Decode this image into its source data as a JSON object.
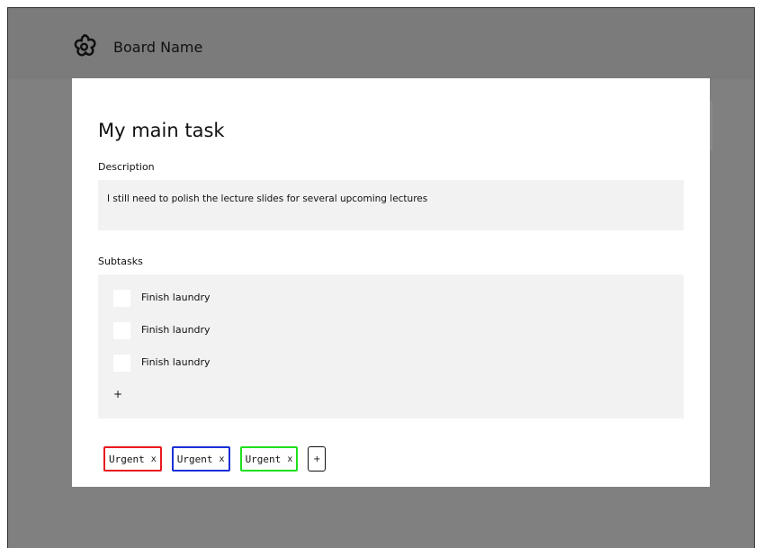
{
  "header": {
    "board_name": "Board Name",
    "logo_icon": "flower-icon"
  },
  "task": {
    "title": "My main task",
    "description_label": "Description",
    "description": "I still need to polish the lecture slides for several upcoming lectures",
    "subtasks_label": "Subtasks",
    "subtasks": [
      {
        "label": "Finish laundry",
        "checked": false
      },
      {
        "label": "Finish laundry",
        "checked": false
      },
      {
        "label": "Finish laundry",
        "checked": false
      }
    ],
    "add_subtask_label": "+"
  },
  "tags": {
    "items": [
      {
        "label": "Urgent",
        "remove_label": "x",
        "color": "#e8191e"
      },
      {
        "label": "Urgent",
        "remove_label": "x",
        "color": "#1a2fd8"
      },
      {
        "label": "Urgent",
        "remove_label": "x",
        "color": "#1ee01e"
      }
    ],
    "add_label": "+"
  },
  "colors": {
    "overlay": "#808080",
    "panel_bg": "#f2f2f2",
    "modal_bg": "#ffffff"
  }
}
